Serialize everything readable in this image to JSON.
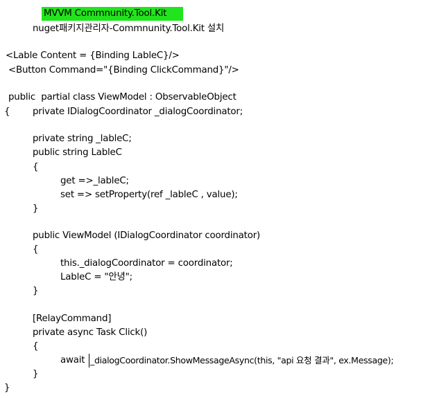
{
  "document": {
    "highlight_color": "#22e41c",
    "lines": [
      "MVVM Commnunity.Tool.Kit",
      "nuget패키지관리자-Commnunity.Tool.Kit 설치",
      "<Lable Content = {Binding LableC}/>",
      "<Button Command=\"{Binding ClickCommand}\"/>",
      "public  partial class ViewModel : ObservableObject",
      "{",
      "private IDialogCoordinator _dialogCoordinator;",
      "private string _lableC;",
      "public string LableC",
      "{",
      "get =>_lableC;",
      "set => setProperty(ref _lableC , value);",
      "}",
      "public ViewModel (IDialogCoordinator coordinator)",
      "{",
      "this._dialogCoordinator = coordinator;",
      "LableC = \"안녕\";",
      "}",
      "[RelayCommand]",
      "private async Task Click()",
      "{",
      "await",
      "_dialogCoordinator.ShowMessageAsync(this, \"api 요청 결과\", ex.Message);",
      "}",
      "}"
    ]
  }
}
